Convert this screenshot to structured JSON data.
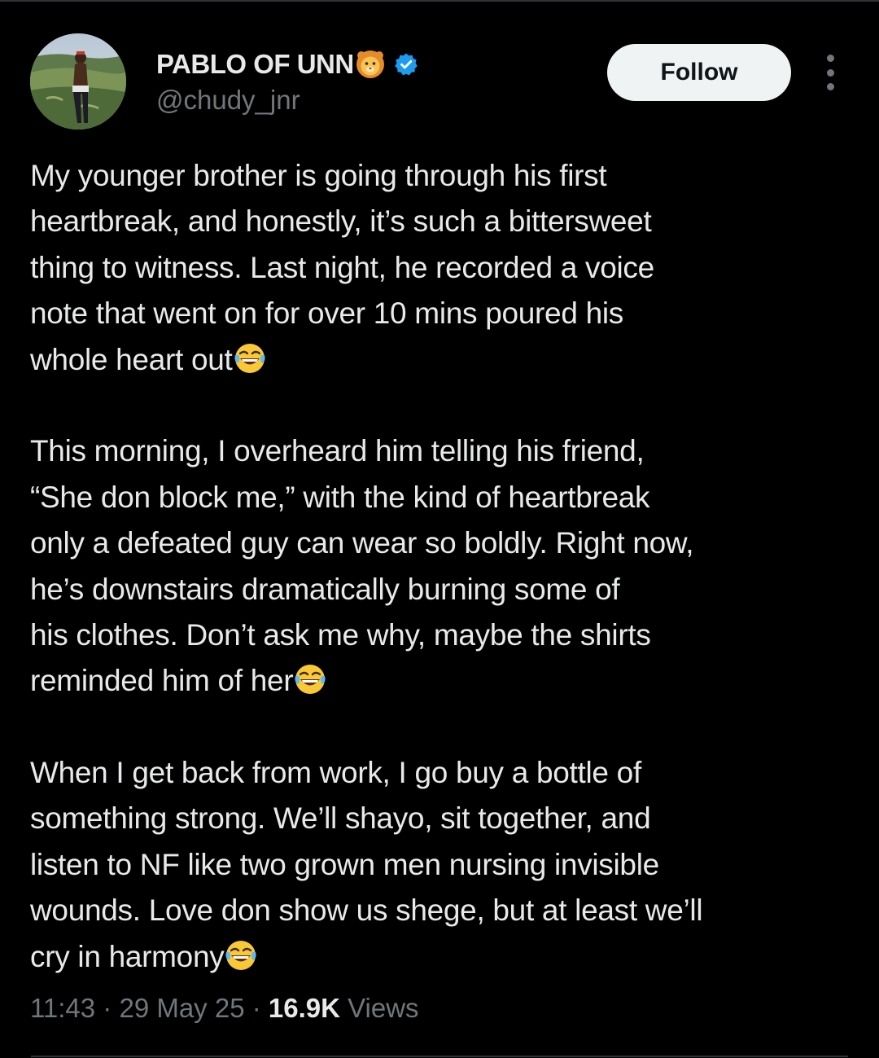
{
  "author": {
    "display_name": "PABLO OF UNN",
    "handle": "@chudy_jnr",
    "name_emoji": "lion-face-icon",
    "verified": true,
    "verified_color": "#1d9bf0"
  },
  "actions": {
    "follow_label": "Follow",
    "more_icon": "more-vertical-icon"
  },
  "tweet": {
    "paragraphs": [
      {
        "lines": [
          "My younger brother is going through his first",
          "heartbreak, and honestly, it’s such a bittersweet",
          "thing to witness. Last night, he recorded a voice",
          "note that went on for over 10 mins poured his",
          "whole heart out"
        ],
        "end_emoji": "face-with-tears-of-joy-icon"
      },
      {
        "lines": [
          "This morning, I overheard him telling his friend,",
          "“She don block me,” with the kind of heartbreak",
          "only a defeated guy can wear so boldly. Right now,",
          "he’s downstairs dramatically burning some of",
          "his clothes. Don’t ask me why, maybe the shirts",
          "reminded him of her"
        ],
        "end_emoji": "face-with-tears-of-joy-icon"
      },
      {
        "lines": [
          "When I get back from work, I go buy a bottle of",
          "something strong. We’ll shayo, sit together, and",
          "listen to NF like two grown men nursing invisible",
          "wounds. Love don show us shege, but at least we’ll",
          "cry in harmony"
        ],
        "end_emoji": "face-with-tears-of-joy-icon"
      }
    ]
  },
  "meta": {
    "time": "11:43",
    "separator": " · ",
    "date": "29 May 25",
    "views_count": "16.9K",
    "views_label": "Views"
  },
  "colors": {
    "background": "#000000",
    "text_primary": "#e7e9ea",
    "text_secondary": "#71767b",
    "follow_button_bg": "#eff3f4",
    "follow_button_text": "#0f1419"
  }
}
